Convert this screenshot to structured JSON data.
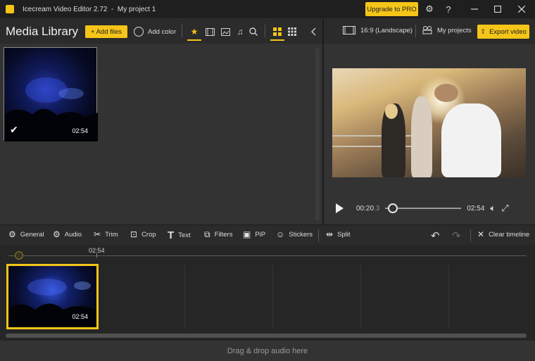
{
  "titlebar": {
    "title": "Icecream Video Editor 2.72  -  My project 1",
    "upgrade_label": "Upgrade to PRO",
    "icons": [
      "gear-icon",
      "help-icon",
      "minimize-icon",
      "maximize-icon",
      "close-icon"
    ]
  },
  "library": {
    "title": "Media Library",
    "add_files_label": "+ Add files",
    "add_color_label": "Add color",
    "thumb_duration": "02:54"
  },
  "preview": {
    "aspect_label": "16:9 (Landscape)",
    "my_projects_label": "My projects",
    "export_label": "Export video",
    "current_time": "00:20",
    "current_time_frac": ".3",
    "total_time": "02:54",
    "progress": 0.12
  },
  "edit_toolbar": {
    "general": "General",
    "audio": "Audio",
    "trim": "Trim",
    "crop": "Crop",
    "text": "Text",
    "filters": "Filters",
    "pip": "PiP",
    "stickers": "Stickers",
    "split": "Split",
    "clear": "Clear timeline"
  },
  "timeline": {
    "ruler_label": "02:54",
    "clip_duration": "02:54"
  },
  "audio_drop": "Drag & drop audio here",
  "colors": {
    "accent": "#f5c518",
    "background": "#2b2b2b"
  }
}
